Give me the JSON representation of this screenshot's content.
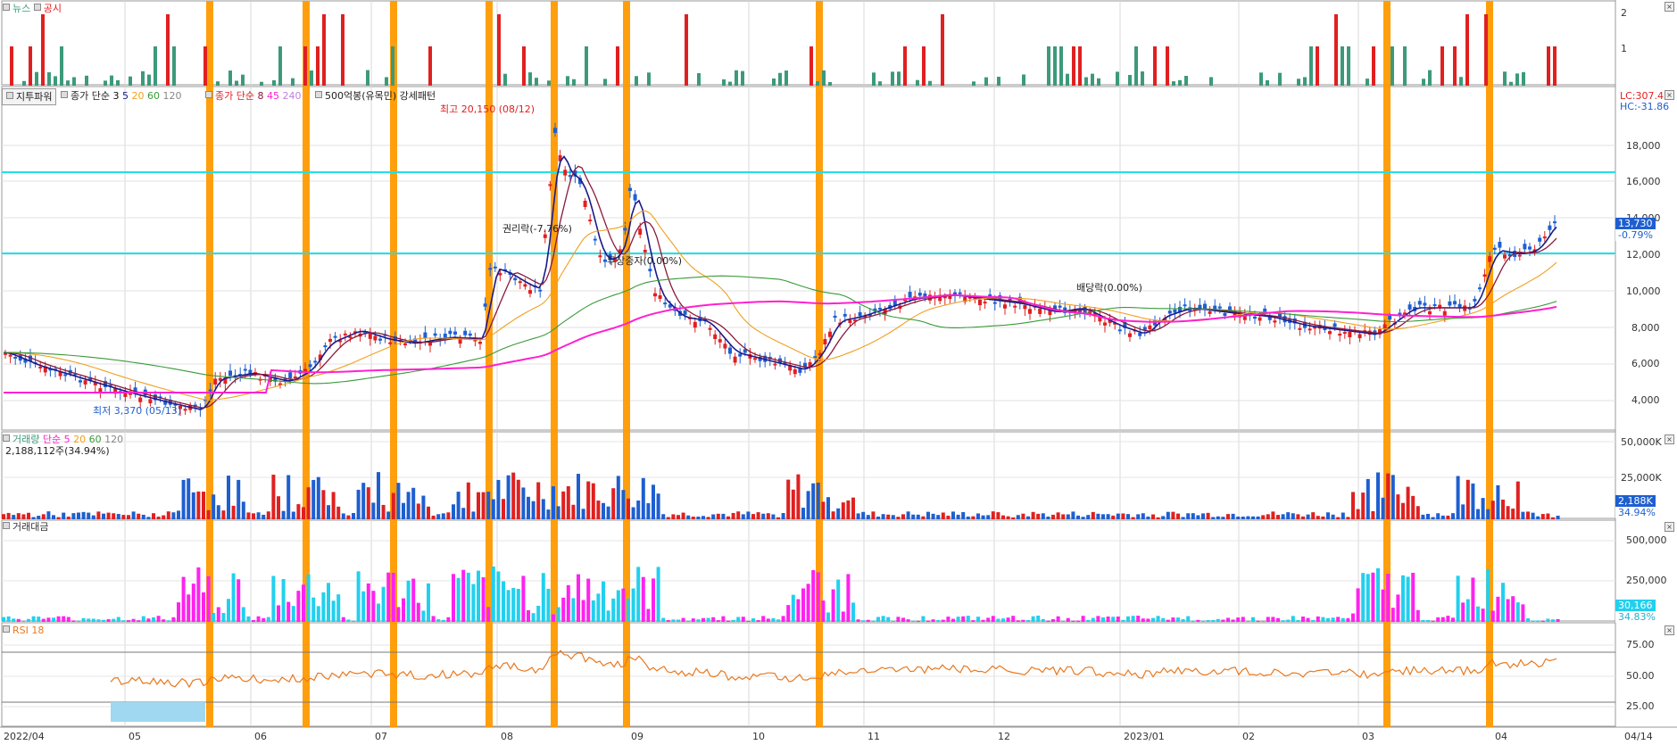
{
  "news_panel": {
    "news_label": "뉴스",
    "disclosure_label": "공시",
    "y_ticks": [
      "2",
      "1"
    ]
  },
  "price_panel": {
    "header": {
      "indicator_button": "지투파워",
      "ma_label": "종가 단순",
      "ma_periods": [
        "3",
        "5",
        "20",
        "60",
        "120"
      ],
      "ma2_label": "종가 단순",
      "ma2_periods": [
        "8",
        "45",
        "240"
      ],
      "pattern_label": "500억봉(유목민) 강세패턴"
    },
    "right_labels": {
      "lc": "LC:307.42",
      "hc": "HC:-31.86"
    },
    "annotations": {
      "high": "최고 20,150 (08/12)",
      "low": "최저 3,370 (05/13)",
      "rights": "권리락(-7.76%)",
      "bonus": "무상증자(0.00%)",
      "dividend": "배당락(0.00%)"
    },
    "y_ticks": [
      "18,000",
      "16,000",
      "14,000",
      "12,000",
      "10,000",
      "8,000",
      "6,000",
      "4,000"
    ],
    "current_price": "13,730",
    "current_change": "-0.79%"
  },
  "volume_panel": {
    "title": "거래량",
    "ma_label": "단순",
    "ma_periods": [
      "5",
      "20",
      "60",
      "120"
    ],
    "value_text": "2,188,112주(34.94%)",
    "y_ticks": [
      "50,000K",
      "25,000K"
    ],
    "tag_value": "2,188K",
    "tag_pct": "34.94%"
  },
  "amount_panel": {
    "title": "거래대금",
    "y_ticks": [
      "500,000",
      "250,000"
    ],
    "tag_value": "30,166",
    "tag_pct": "34.83%"
  },
  "rsi_panel": {
    "title": "RSI 18",
    "y_ticks": [
      "75.00",
      "50.00",
      "25.00"
    ]
  },
  "x_axis": {
    "labels": [
      "2022/04",
      "05",
      "06",
      "07",
      "08",
      "09",
      "10",
      "11",
      "12",
      "2023/01",
      "02",
      "03",
      "04",
      "04/14"
    ]
  },
  "colors": {
    "up": "#e02020",
    "down": "#1e5fd0",
    "highlight": "#ff9a00",
    "support": "#22e0e8",
    "ma_pink": "#ff20d0",
    "ma_orange": "#f0a020",
    "ma_green": "#3a9a3a",
    "ma_navy": "#1a1a8a",
    "ma_maroon": "#8a1a3a",
    "news_bar": "#3c9a7a",
    "amount_bar_a": "#ff22ee",
    "amount_bar_b": "#22d0ee",
    "rsi_line": "#e8781e",
    "rsi_fill": "#9fd8f0"
  }
}
